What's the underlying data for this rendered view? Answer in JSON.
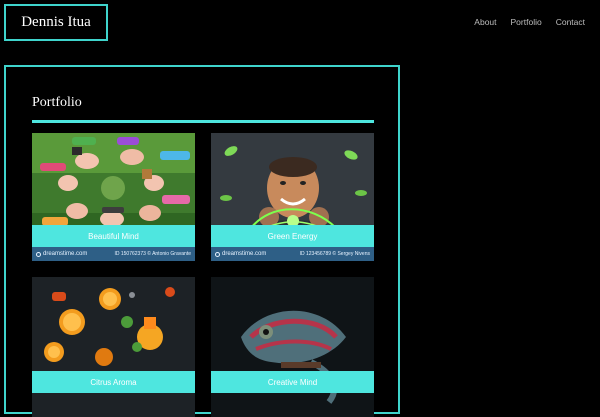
{
  "header": {
    "brand": "Dennis Itua",
    "nav": [
      "About",
      "Portfolio",
      "Contact"
    ]
  },
  "portfolio": {
    "title": "Portfolio",
    "items": [
      {
        "label": "Beautiful Mind",
        "watermark": "dreamstime.com",
        "id_text": "ID 150762373 © Antonio Gravante"
      },
      {
        "label": "Green Energy",
        "watermark": "dreamstime.com",
        "id_text": "ID 123456789 © Sergey Nivens"
      },
      {
        "label": "Citrus Aroma",
        "watermark": "",
        "id_text": ""
      },
      {
        "label": "Creative Mind",
        "watermark": "",
        "id_text": ""
      }
    ]
  },
  "colors": {
    "accent": "#4ee6df",
    "border": "#3fd4cc",
    "background": "#000000"
  }
}
